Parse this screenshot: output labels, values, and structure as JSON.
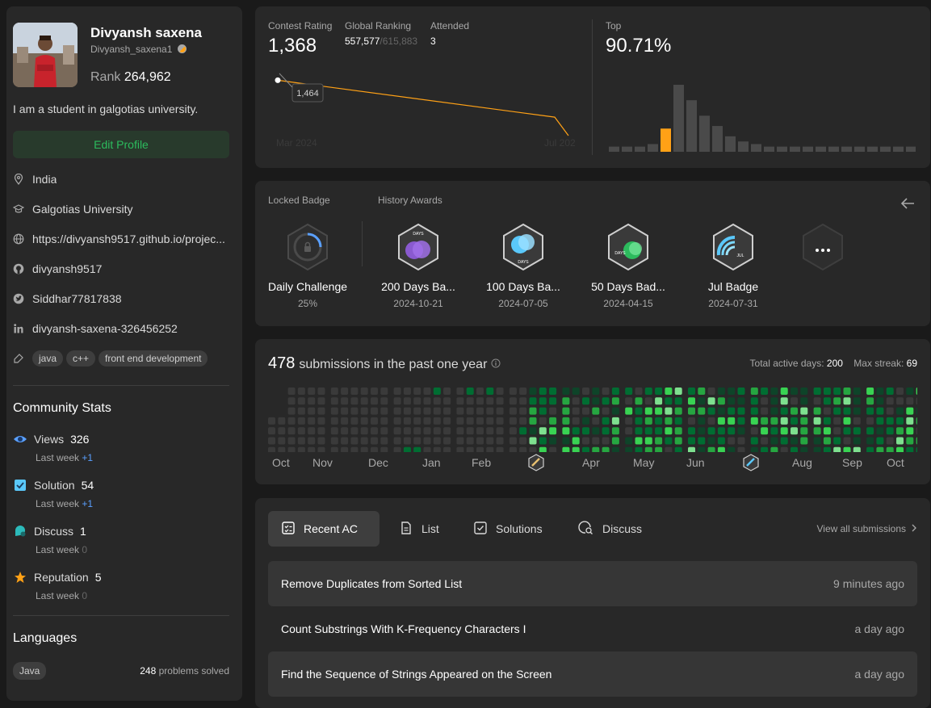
{
  "profile": {
    "name": "Divyansh saxena",
    "handle": "Divyansh_saxena1",
    "rank_label": "Rank",
    "rank_value": "264,962",
    "bio": "I am a student in galgotias university.",
    "edit_label": "Edit Profile",
    "location": "India",
    "school": "Galgotias University",
    "website": "https://divyansh9517.github.io/projec...",
    "github": "divyansh9517",
    "twitter": "Siddhar77817838",
    "linkedin": "divyansh-saxena-326456252",
    "tags": [
      "java",
      "c++",
      "front end development"
    ]
  },
  "community": {
    "title": "Community Stats",
    "items": [
      {
        "label": "Views",
        "value": "326",
        "sub": "Last week",
        "delta": "+1",
        "color": "#5aa0ff"
      },
      {
        "label": "Solution",
        "value": "54",
        "sub": "Last week",
        "delta": "+1",
        "color": "#5aa0ff"
      },
      {
        "label": "Discuss",
        "value": "1",
        "sub": "Last week",
        "delta": "0",
        "color": "#2cbbbb"
      },
      {
        "label": "Reputation",
        "value": "5",
        "sub": "Last week",
        "delta": "0",
        "color": "#ffa116"
      }
    ]
  },
  "languages": {
    "title": "Languages",
    "items": [
      {
        "name": "Java",
        "count": "248",
        "suffix": "problems solved"
      }
    ]
  },
  "contest": {
    "rating_label": "Contest Rating",
    "rating": "1,368",
    "global_label": "Global Ranking",
    "global": "557,577",
    "global_total": "/615,883",
    "attended_label": "Attended",
    "attended": "3",
    "top_label": "Top",
    "top": "90.71%",
    "tooltip": "1,464",
    "x_start": "Mar 2024",
    "x_end": "Jul 2024",
    "highlight_color": "#ffa116"
  },
  "chart_data": {
    "type": "line",
    "x": [
      "Mar 2024",
      "Jul 2024",
      "Jul 2024"
    ],
    "y": [
      1464,
      1400,
      1368
    ],
    "ylim": [
      1340,
      1480
    ],
    "histogram": {
      "type": "bar",
      "values": [
        2,
        2,
        2,
        3,
        9,
        26,
        20,
        14,
        10,
        6,
        4,
        3,
        2,
        2,
        2,
        2,
        2,
        2,
        2,
        2,
        2,
        2,
        2,
        2
      ],
      "highlight_index": 4
    }
  },
  "badges": {
    "locked_label": "Locked Badge",
    "history_label": "History Awards",
    "locked": {
      "title": "Daily Challenge",
      "date": "25%"
    },
    "items": [
      {
        "title": "200 Days Ba...",
        "date": "2024-10-21",
        "icon": "200-days-badge-icon",
        "text": "DAYS"
      },
      {
        "title": "100 Days Ba...",
        "date": "2024-07-05",
        "icon": "100-days-badge-icon",
        "text": "DAYS"
      },
      {
        "title": "50 Days Bad...",
        "date": "2024-04-15",
        "icon": "50-days-badge-icon",
        "text": "DAYS"
      },
      {
        "title": "Jul Badge",
        "date": "2024-07-31",
        "icon": "jul-badge-icon",
        "text": "JUL"
      }
    ]
  },
  "submissions": {
    "count": "478",
    "label": "submissions in the past one year",
    "active_label": "Total active days:",
    "active": "200",
    "streak_label": "Max streak:",
    "streak": "69",
    "months": [
      "Oct",
      "Nov",
      "Dec",
      "Jan",
      "Feb",
      "Apr",
      "May",
      "Jun",
      "Aug",
      "Sep",
      "Oct"
    ]
  },
  "recent": {
    "tabs": [
      "Recent AC",
      "List",
      "Solutions",
      "Discuss"
    ],
    "view_all": "View all submissions",
    "rows": [
      {
        "title": "Remove Duplicates from Sorted List",
        "time": "9 minutes ago"
      },
      {
        "title": "Count Substrings With K-Frequency Characters I",
        "time": "a day ago"
      },
      {
        "title": "Find the Sequence of Strings Appeared on the Screen",
        "time": "a day ago"
      }
    ]
  }
}
